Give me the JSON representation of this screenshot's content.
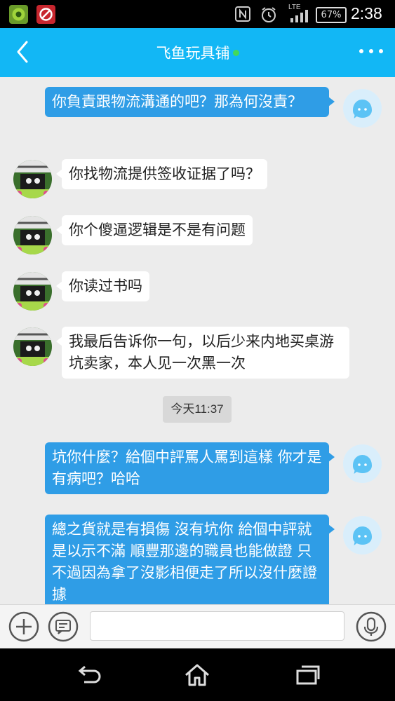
{
  "status_bar": {
    "app_icons": [
      "game-app-icon",
      "blocked-app-icon"
    ],
    "signal_icons": [
      "nfc-icon",
      "alarm-icon",
      "lte-signal-icon"
    ],
    "network": "LTE",
    "battery": "67%",
    "time": "2:38"
  },
  "header": {
    "title": "飞鱼玩具铺",
    "status_color": "#43d85a"
  },
  "messages": [
    {
      "side": "out",
      "text": "你負責跟物流溝通的吧？那為何沒責？"
    },
    {
      "side": "in",
      "text": "你找物流提供签收证据了吗？"
    },
    {
      "side": "in",
      "text": "你个傻逼逻辑是不是有问题"
    },
    {
      "side": "in",
      "text": "你读过书吗"
    },
    {
      "side": "in",
      "text": "我最后告诉你一句，以后少来内地买桌游坑卖家，本人见一次黑一次"
    },
    {
      "side": "out",
      "text": "坑你什麼？給個中評罵人罵到這樣 你才是有病吧？哈哈"
    },
    {
      "side": "out",
      "text": "總之貨就是有損傷 沒有坑你 給個中評就是以示不滿 順豐那邊的職員也能做證 只不過因為拿了沒影相便走了所以沒什麼證據"
    }
  ],
  "timestamp": "今天11:37",
  "input_bar": {
    "placeholder": "",
    "buttons": [
      "add-icon",
      "emoji-icon",
      "voice-icon"
    ]
  },
  "colors": {
    "accent": "#12b7f5",
    "bubble_out": "#2f9de6",
    "bubble_in": "#ffffff"
  }
}
